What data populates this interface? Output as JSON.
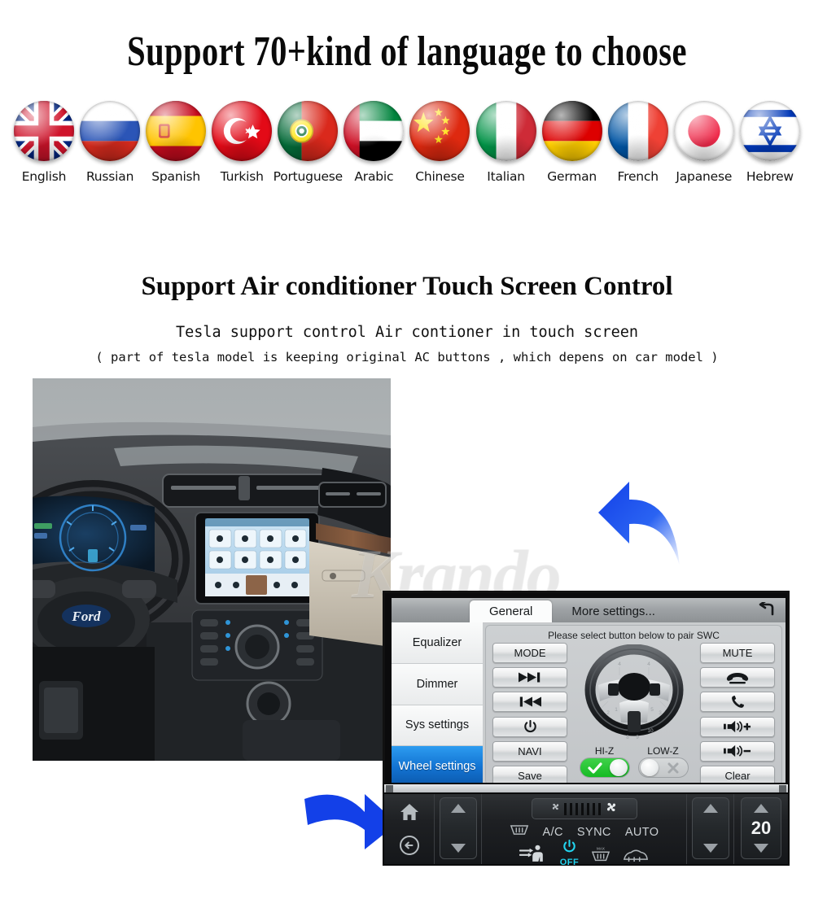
{
  "section_languages": {
    "title": "Support 70+kind of  language to choose",
    "flags": [
      {
        "label": "English",
        "icon": "flag-uk-icon"
      },
      {
        "label": "Russian",
        "icon": "flag-russia-icon"
      },
      {
        "label": "Spanish",
        "icon": "flag-spain-icon"
      },
      {
        "label": "Turkish",
        "icon": "flag-turkey-icon"
      },
      {
        "label": "Portuguese",
        "icon": "flag-portugal-icon"
      },
      {
        "label": "Arabic",
        "icon": "flag-uae-icon"
      },
      {
        "label": "Chinese",
        "icon": "flag-china-icon"
      },
      {
        "label": "Italian",
        "icon": "flag-italy-icon"
      },
      {
        "label": "German",
        "icon": "flag-germany-icon"
      },
      {
        "label": "French",
        "icon": "flag-france-icon"
      },
      {
        "label": "Japanese",
        "icon": "flag-japan-icon"
      },
      {
        "label": "Hebrew",
        "icon": "flag-israel-icon"
      }
    ]
  },
  "section_ac": {
    "title": "Support Air conditioner Touch Screen Control",
    "subtitle_1": "Tesla support control Air contioner in touch screen",
    "subtitle_2": "( part of tesla model is keeping original AC buttons , which depens on car model )"
  },
  "watermark": "Krando",
  "settings_unit": {
    "tabs": [
      {
        "label": "General",
        "active": true
      },
      {
        "label": "More settings...",
        "active": false
      }
    ],
    "back_icon": "back-arrow-icon",
    "sidebar": [
      {
        "label": "Equalizer",
        "active": false
      },
      {
        "label": "Dimmer",
        "active": false
      },
      {
        "label": "Sys settings",
        "active": false
      },
      {
        "label": "Wheel settings",
        "active": true
      }
    ],
    "hint": "Please select button below to pair SWC",
    "left_buttons": [
      {
        "label": "MODE",
        "icon": ""
      },
      {
        "label": "",
        "icon": "next-track-icon"
      },
      {
        "label": "",
        "icon": "prev-track-icon"
      },
      {
        "label": "",
        "icon": "power-icon"
      },
      {
        "label": "NAVI",
        "icon": ""
      },
      {
        "label": "Save",
        "icon": ""
      }
    ],
    "right_buttons": [
      {
        "label": "MUTE",
        "icon": ""
      },
      {
        "label": "",
        "icon": "hangup-phone-icon"
      },
      {
        "label": "",
        "icon": "call-phone-icon"
      },
      {
        "label": "",
        "icon": "volume-up-icon"
      },
      {
        "label": "",
        "icon": "volume-down-icon"
      },
      {
        "label": "Clear",
        "icon": ""
      }
    ],
    "steering_wheel_icon": "steering-wheel-diagram",
    "impedance": [
      {
        "label": "HI-Z",
        "state": "on",
        "mark": "check-icon"
      },
      {
        "label": "LOW-Z",
        "state": "off",
        "mark": "cross-icon"
      }
    ]
  },
  "ac_bar": {
    "home_icon": "home-icon",
    "back_icon": "back-circle-icon",
    "left_stepper": {
      "up": "chevron-up-icon",
      "down": "chevron-down-icon"
    },
    "right_stepper": {
      "up": "chevron-up-icon",
      "down": "chevron-down-icon"
    },
    "fan_slider": {
      "min_icon": "fan-small-icon",
      "max_icon": "fan-large-icon",
      "bars": 7
    },
    "labels": [
      "A/C",
      "SYNC",
      "AUTO"
    ],
    "rear_defrost_icon": "rear-defrost-icon",
    "airflow_seat_icon": "airflow-seat-icon",
    "max_defrost_icon": "max-defrost-icon",
    "front_defrost_icon": "front-defrost-icon",
    "power": {
      "icon": "power-icon",
      "label": "OFF",
      "color": "#22d3ee"
    },
    "temperature": "20"
  },
  "colors": {
    "accent_blue": "#1373d2",
    "toggle_green": "#16bb24",
    "ac_cyan": "#22d3ee",
    "arrow_blue": "#1340e8"
  }
}
